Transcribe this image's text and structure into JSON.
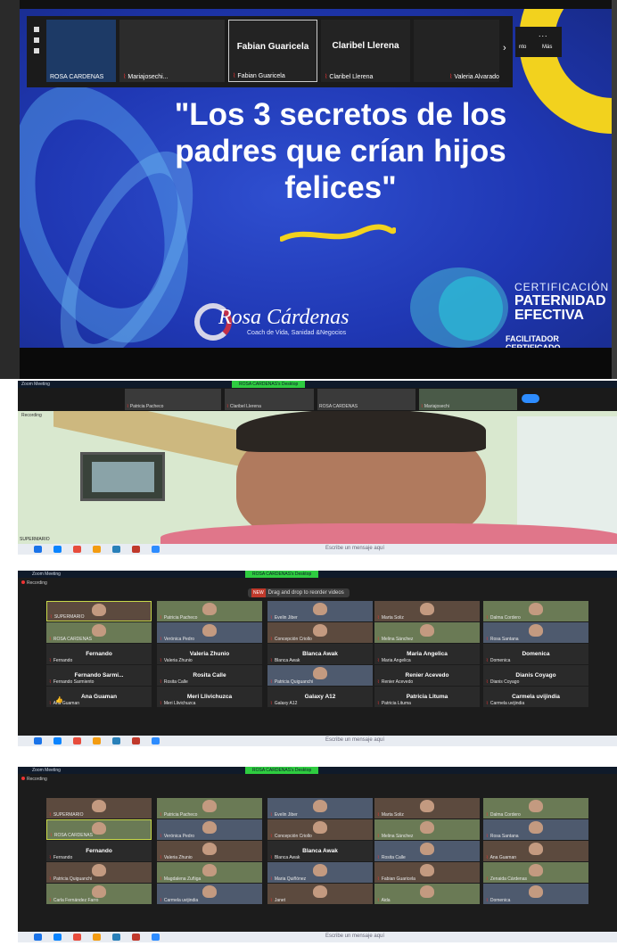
{
  "slide": {
    "title": "\"Los 3 secretos de los padres que crían hijos felices\"",
    "brand_name": "Rosa Cárdenas",
    "brand_tagline": "Coach de Vida, Sanidad &Negocios",
    "cert_line1": "CERTIFICACIÓN",
    "cert_line2": "PATERNIDAD EFECTIVA",
    "cert_line3": "FACILITADOR CERTIFICADO",
    "brand_color": "#1f37b3",
    "accent_color": "#f2d21e"
  },
  "zoom_strip": {
    "tiles": [
      {
        "name": "ROSA CARDENAS",
        "big": ""
      },
      {
        "name": "Mariajosechi...",
        "big": ""
      },
      {
        "name": "Fabian Guaricela",
        "big": "Fabian Guaricela"
      },
      {
        "name": "Claribel Llerena",
        "big": "Claribel Llerena"
      },
      {
        "name": "Valeria Alvarado",
        "big": ""
      }
    ],
    "more_dots": "...",
    "more_label_1": "nto",
    "more_label_2": "Más",
    "next_icon": "›"
  },
  "speaker_view": {
    "window_title": "Zoom Meeting",
    "banner": "ROSA CARDENAS's Desktop",
    "recording": "Recording",
    "strip_names": [
      "Patricia Pacheco",
      "Claribel Llerena",
      "ROSA CARDENAS",
      "Mariajosechi"
    ],
    "speaker_name": "SUPERMARIO",
    "chat_placeholder": "Escribe un mensaje aquí"
  },
  "gallery_1": {
    "window_title": "Zoom Meeting",
    "banner": "ROSA CARDENAS's Desktop",
    "recording": "Recording",
    "drag_new": "NEW",
    "drag_text": "Drag and drop to reorder videos",
    "rows": [
      [
        {
          "n": "SUPERMARIO",
          "v": true,
          "hl": true
        },
        {
          "n": "Patricia Pacheco",
          "v": true
        },
        {
          "n": "Evelin Jiber",
          "v": true
        },
        {
          "n": "Marta Soliz",
          "v": true
        },
        {
          "n": "Dalma Cordero",
          "v": true
        }
      ],
      [
        {
          "n": "ROSA CARDENAS",
          "v": true
        },
        {
          "n": "Verónica Pedro",
          "v": true
        },
        {
          "n": "Concepción Criollo",
          "v": true
        },
        {
          "n": "Melina Sánchez",
          "v": true
        },
        {
          "n": "Rosa Santana",
          "v": true
        }
      ],
      [
        {
          "n": "Fernando",
          "b": "Fernando"
        },
        {
          "n": "Valeria Zhunio",
          "b": "Valeria Zhunio"
        },
        {
          "n": "Blanca Awak",
          "b": "Blanca Awak"
        },
        {
          "n": "Maria Angelica",
          "b": "Maria Angelica"
        },
        {
          "n": "Domenica",
          "b": "Domenica"
        }
      ],
      [
        {
          "n": "Fernando Sarmiento",
          "b": "Fernando Sarmi..."
        },
        {
          "n": "Rosita Calle",
          "b": "Rosita Calle"
        },
        {
          "n": "Patricia Quiguanchi",
          "v": true
        },
        {
          "n": "Renier Acevedo",
          "b": "Renier Acevedo"
        },
        {
          "n": "Dianis Coyago",
          "b": "Dianis Coyago"
        }
      ],
      [
        {
          "n": "Ana Guaman",
          "b": "Ana Guaman"
        },
        {
          "n": "Meri Llivichuzca",
          "b": "Meri Llivichuzca"
        },
        {
          "n": "Galaxy A12",
          "b": "Galaxy A12"
        },
        {
          "n": "Patricia Lituma",
          "b": "Patricia Lituma"
        },
        {
          "n": "Carmela uvijindia",
          "b": "Carmela uvijindia"
        }
      ]
    ],
    "thumb": "👍",
    "chat_placeholder": "Escribe un mensaje aquí"
  },
  "gallery_2": {
    "window_title": "Zoom Meeting",
    "banner": "ROSA CARDENAS's Desktop",
    "recording": "Recording",
    "rows": [
      [
        {
          "n": "SUPERMARIO",
          "v": true
        },
        {
          "n": "Patricia Pacheco",
          "v": true
        },
        {
          "n": "Evelin Jiber",
          "v": true
        },
        {
          "n": "Marta Soliz",
          "v": true
        },
        {
          "n": "Dalma Cordero",
          "v": true
        }
      ],
      [
        {
          "n": "ROSA CARDENAS",
          "v": true,
          "hl": true
        },
        {
          "n": "Verónica Pedro",
          "v": true
        },
        {
          "n": "Concepción Criollo",
          "v": true
        },
        {
          "n": "Melina Sánchez",
          "v": true
        },
        {
          "n": "Rosa Santana",
          "v": true
        }
      ],
      [
        {
          "n": "Fernando",
          "b": "Fernando"
        },
        {
          "n": "Valeria Zhunio",
          "v": true
        },
        {
          "n": "Blanca Awak",
          "b": "Blanca Awak"
        },
        {
          "n": "Rosita Calle",
          "v": true
        },
        {
          "n": "Ana Guaman",
          "v": true
        }
      ],
      [
        {
          "n": "Patricia Quiguanchi",
          "v": true
        },
        {
          "n": "Magdalena Zuñiga",
          "v": true
        },
        {
          "n": "Maria Quiñónez",
          "v": true
        },
        {
          "n": "Fabian Guaricela",
          "v": true
        },
        {
          "n": "Zenaida Cárdenas",
          "v": true
        }
      ],
      [
        {
          "n": "Carla Fernández Farro",
          "v": true
        },
        {
          "n": "Carmela uvijindia",
          "v": true
        },
        {
          "n": "Janet",
          "v": true
        },
        {
          "n": "Aida",
          "v": true
        },
        {
          "n": "Domenica",
          "v": true
        }
      ]
    ],
    "chat_placeholder": "Escribe un mensaje aquí"
  }
}
